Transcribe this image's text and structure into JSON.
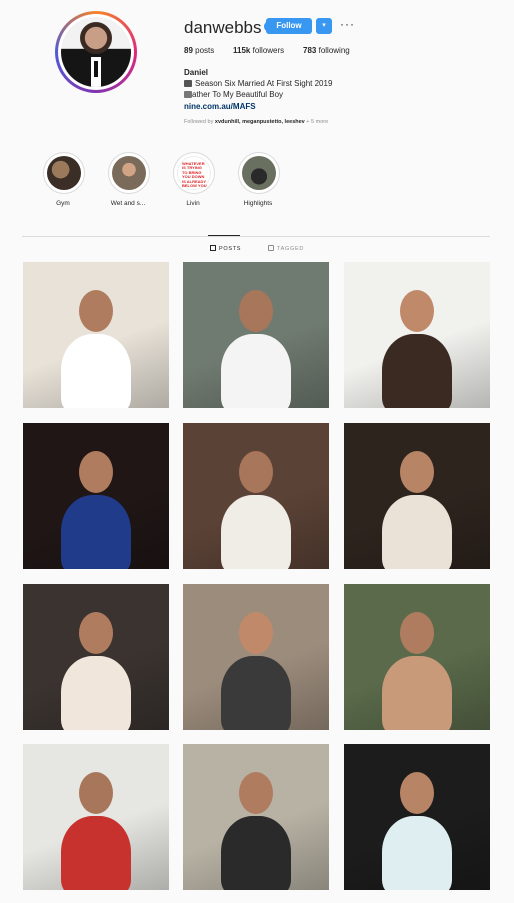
{
  "profile": {
    "username": "danwebbs",
    "verified_symbol": "✓",
    "follow_label": "Follow",
    "dropdown_symbol": "▾",
    "more_symbol": "···",
    "stats": {
      "posts_count": "89",
      "posts_label": "posts",
      "followers_count": "115k",
      "followers_label": "followers",
      "following_count": "783",
      "following_label": "following"
    },
    "bio": {
      "name": "Daniel",
      "line1": "Season Six Married At First Sight 2019",
      "line2": "ather To My Beautiful Boy",
      "link": "nine.com.au/MAFS",
      "followed_by_prefix": "Followed by",
      "followed_by_names": "xvdunhill, meganpustetto, leeshev",
      "followed_by_more": "+ 5 more"
    }
  },
  "highlights": [
    {
      "label": "Gym",
      "color": "#5a4a3a"
    },
    {
      "label": "Wet and s...",
      "color": "#8a7a6a"
    },
    {
      "label": "Livin",
      "color": "#ffffff",
      "text": "WHATEVER IS TRYING TO BRING YOU DOWN IS ALREADY BELOW YOU"
    },
    {
      "label": "Highlights",
      "color": "#4a4a4a"
    }
  ],
  "tabs": {
    "posts": "POSTS",
    "tagged": "TAGGED"
  },
  "posts": [
    {
      "bg": "#e8e2d8",
      "accent": "#ffffff",
      "skin": "#b07c60"
    },
    {
      "bg": "#6f7a70",
      "accent": "#f4f4f4",
      "skin": "#a8765a"
    },
    {
      "bg": "#f1f1ee",
      "accent": "#3a2a22",
      "skin": "#c0896a"
    },
    {
      "bg": "#201616",
      "accent": "#1f3b8a",
      "skin": "#b07c60"
    },
    {
      "bg": "#5b4236",
      "accent": "#f0ece6",
      "skin": "#a8765a"
    },
    {
      "bg": "#2e241e",
      "accent": "#eae2d6",
      "skin": "#b88466"
    },
    {
      "bg": "#3a3330",
      "accent": "#f0e6dc",
      "skin": "#b07c60"
    },
    {
      "bg": "#9c8c7c",
      "accent": "#3a3a3a",
      "skin": "#c0896a"
    },
    {
      "bg": "#5a6a4a",
      "accent": "#c89a7a",
      "skin": "#b07c60"
    },
    {
      "bg": "#e6e6e2",
      "accent": "#c8322e",
      "skin": "#a8765a"
    },
    {
      "bg": "#b8b2a4",
      "accent": "#2a2a2a",
      "skin": "#b07c60"
    },
    {
      "bg": "#1c1c1c",
      "accent": "#dfeef0",
      "skin": "#b88466"
    }
  ]
}
